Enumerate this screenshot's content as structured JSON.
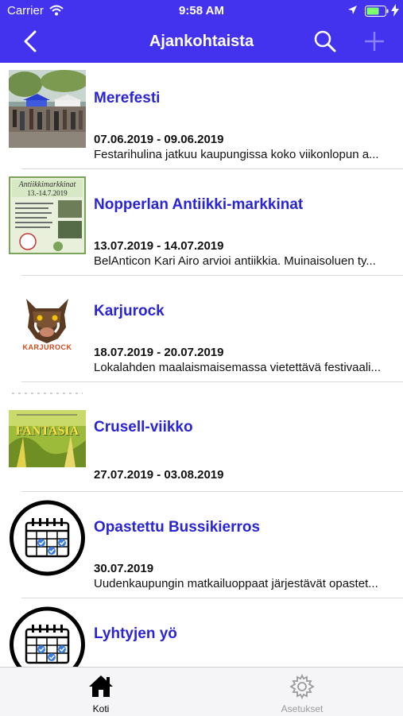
{
  "status_bar": {
    "carrier": "Carrier",
    "time": "9:58 AM"
  },
  "nav": {
    "title": "Ajankohtaista"
  },
  "events": [
    {
      "title": "Merefesti",
      "dates": "07.06.2019 - 09.06.2019",
      "description": "Festarihulina jatkuu kaupungissa koko viikonlopun a..."
    },
    {
      "title": "Nopperlan Antiikki-markkinat",
      "dates": "13.07.2019 - 14.07.2019",
      "description": "BelAnticon Kari Airo arvioi antiikkia. Muinaisoluen ty...",
      "poster": {
        "heading": "Antiikkimarkkinat",
        "date": "13.-14.7.2019"
      }
    },
    {
      "title": "Karjurock",
      "dates": "18.07.2019 - 20.07.2019",
      "description": "Lokalahden maalaismaisemassa vietettävä festivaali...",
      "logo_text": "KARJUROCK"
    },
    {
      "title": "Crusell-viikko",
      "dates": "27.07.2019 - 03.08.2019",
      "description": "",
      "poster": {
        "heading": "FANTASIA"
      }
    },
    {
      "title": "Opastettu Bussikierros",
      "dates": "30.07.2019",
      "description": "Uudenkaupungin matkailuoppaat järjestävät opastet...",
      "icon": "calendar-icon"
    },
    {
      "title": "Lyhtyjen yö",
      "dates": "",
      "description": "",
      "icon": "calendar-icon"
    }
  ],
  "tab_bar": {
    "home_label": "Koti",
    "settings_label": "Asetukset",
    "active_color": "#000000",
    "inactive_color": "#9b9b9b"
  },
  "colors": {
    "accent": "#4433ee",
    "title": "#2a24d8"
  }
}
